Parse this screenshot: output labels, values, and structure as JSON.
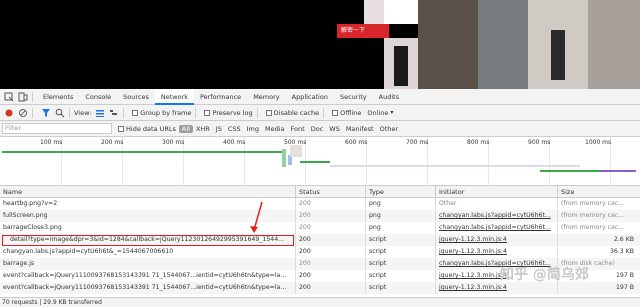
{
  "preview": {
    "banner_label": "解密一下",
    "colors": {
      "black": "#000000",
      "red": "#d8262c"
    }
  },
  "devtools": {
    "tabs": [
      "Elements",
      "Console",
      "Sources",
      "Network",
      "Performance",
      "Memory",
      "Application",
      "Security",
      "Audits"
    ],
    "active_tab": "Network",
    "toolbar": {
      "view_label": "View:",
      "group_by_frame": "Group by frame",
      "preserve_log": "Preserve log",
      "disable_cache": "Disable cache",
      "offline": "Offline",
      "online": "Online"
    },
    "filter": {
      "placeholder": "Filter",
      "hide_data_urls": "Hide data URLs",
      "types": [
        "All",
        "XHR",
        "JS",
        "CSS",
        "Img",
        "Media",
        "Font",
        "Doc",
        "WS",
        "Manifest",
        "Other"
      ]
    },
    "overview_ticks": [
      "100 ms",
      "200 ms",
      "300 ms",
      "400 ms",
      "500 ms",
      "600 ms",
      "700 ms",
      "800 ms",
      "900 ms",
      "1000 ms"
    ],
    "columns": {
      "name": "Name",
      "status": "Status",
      "type": "Type",
      "initiator": "Initiator",
      "size": "Size"
    },
    "rows": [
      {
        "name": "heartbg.png?v=2",
        "status": "200",
        "type": "png",
        "initiator": "Other",
        "size": "(from memory cac..."
      },
      {
        "name": "fullScreen.png",
        "status": "200",
        "type": "png",
        "initiator": "changyan.labs.js?appid=cytU6h6t...",
        "size": "(from memory cac..."
      },
      {
        "name": "barrageClose3.png",
        "status": "200",
        "type": "png",
        "initiator": "changyan.labs.js?appid=cytU6h6t...",
        "size": "(from memory cac..."
      },
      {
        "name": "detail?type=image&dpr=3&id=1284&callback=jQuery11230126492995391649_1544...",
        "status": "200",
        "type": "script",
        "initiator": "jquery-1.12.3.min.js:4",
        "size": "2.6 KB"
      },
      {
        "name": "changyan.labs.js?appid=cytU6h6t&_=1544067006610",
        "status": "200",
        "type": "script",
        "initiator": "jquery-1.12.3.min.js:4",
        "size": "36.3 KB"
      },
      {
        "name": "barrage.js",
        "status": "200",
        "type": "script",
        "initiator": "changyan.labs.js?appid=cytU6h6t...",
        "size": "(from disk cache)"
      },
      {
        "name": "event?callback=jQuery1110093768153143391 71_1544067...ientid=cytU6h6tn&type=la...",
        "status": "200",
        "type": "script",
        "initiator": "jquery-1.12.3.min.js:4",
        "size": "197 B"
      },
      {
        "name": "event?callback=jQuery1110093768153143391 71_1544067...ientid=cytU6h6tn&type=la...",
        "status": "200",
        "type": "script",
        "initiator": "jquery-1.12.3.min.js:4",
        "size": "197 B"
      }
    ],
    "status_bar": "70 requests | 29.9 KB transferred"
  },
  "watermark": "知乎 @简乌郊"
}
